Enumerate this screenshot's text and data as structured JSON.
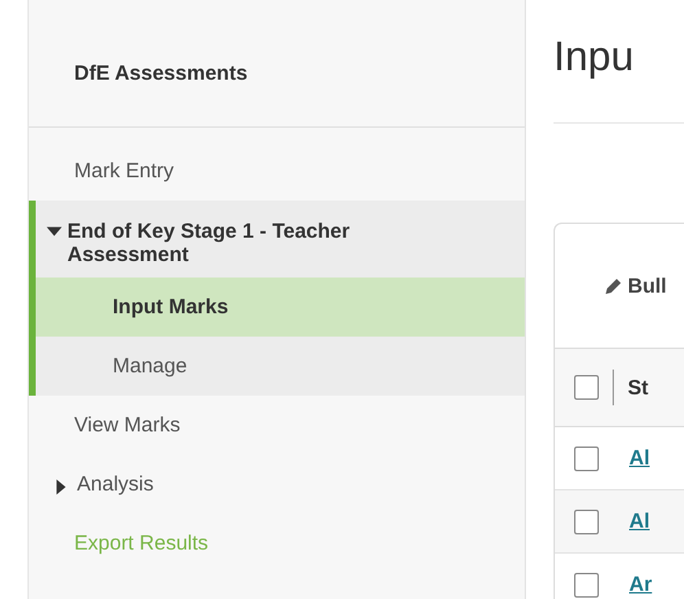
{
  "sidebar": {
    "title": "DfE Assessments",
    "items": [
      {
        "label": "Mark Entry",
        "kind": "link",
        "selected": false
      },
      {
        "label": "End of Key Stage 1 - Teacher Assessment",
        "kind": "group",
        "expanded": true,
        "children": [
          {
            "label": "Input Marks",
            "selected": true
          },
          {
            "label": "Manage",
            "selected": false
          }
        ]
      },
      {
        "label": "View Marks",
        "kind": "link",
        "selected": false
      },
      {
        "label": "Analysis",
        "kind": "group",
        "expanded": false
      },
      {
        "label": "Export Results",
        "kind": "action",
        "selected": false
      }
    ]
  },
  "main": {
    "title": "Inpu",
    "toolbar": {
      "button": "Bull"
    },
    "table": {
      "header": {
        "checked": false,
        "column_1": "St"
      },
      "rows": [
        {
          "name": "Al",
          "checked": false
        },
        {
          "name": "Al",
          "checked": false
        },
        {
          "name": "Ar",
          "checked": false
        }
      ]
    }
  }
}
